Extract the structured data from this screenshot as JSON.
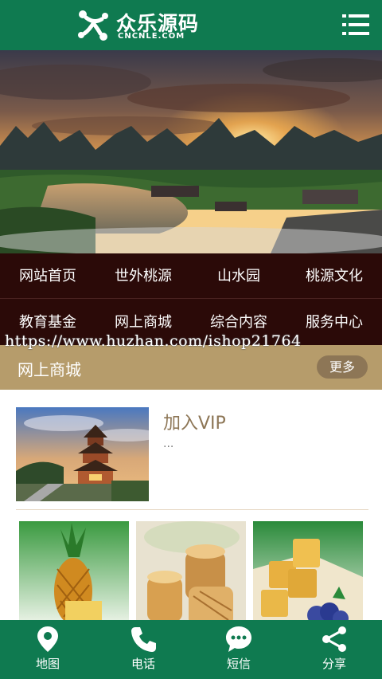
{
  "header": {
    "logo_text": "众乐源码",
    "logo_sub": "CNCNLE.COM",
    "menu_icon": "menu-icon"
  },
  "banner": {
    "slide_count": 2,
    "active_slide": 1
  },
  "nav": {
    "items": [
      {
        "label": "网站首页"
      },
      {
        "label": "世外桃源"
      },
      {
        "label": "山水园"
      },
      {
        "label": "桃源文化"
      },
      {
        "label": "教育基金"
      },
      {
        "label": "网上商城"
      },
      {
        "label": "综合内容"
      },
      {
        "label": "服务中心"
      }
    ]
  },
  "watermark": "https://www.huzhan.com/ishop21764",
  "section": {
    "title": "网上商城",
    "more_label": "更多"
  },
  "featured": {
    "title": "加入VIP",
    "desc": "..."
  },
  "footer": {
    "items": [
      {
        "label": "地图",
        "icon": "map-pin-icon"
      },
      {
        "label": "电话",
        "icon": "phone-icon"
      },
      {
        "label": "短信",
        "icon": "message-icon"
      },
      {
        "label": "分享",
        "icon": "share-icon"
      }
    ]
  },
  "colors": {
    "brand_green": "#0f7a50",
    "nav_bg": "#2b0a08",
    "section_bg": "#b69c6b",
    "accent_gold": "#e8b62a"
  }
}
